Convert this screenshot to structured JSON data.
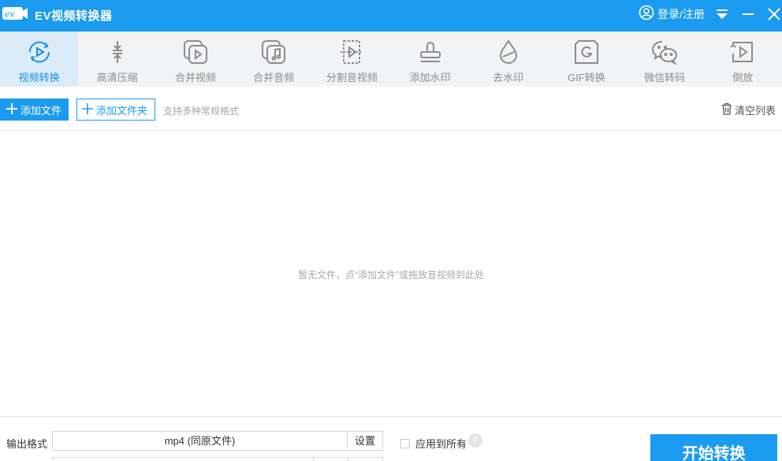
{
  "titlebar": {
    "logo_text": "EV",
    "title": "EV视频转换器",
    "login_label": "登录/注册",
    "icons": [
      "user-icon",
      "dropdown-menu-icon",
      "minimize-icon",
      "close-icon"
    ]
  },
  "toolbar": {
    "items": [
      {
        "label": "视频转换",
        "icon": "video-convert-icon",
        "active": true
      },
      {
        "label": "高清压缩",
        "icon": "compress-icon",
        "active": false
      },
      {
        "label": "合并视频",
        "icon": "merge-video-icon",
        "active": false
      },
      {
        "label": "合并音频",
        "icon": "merge-audio-icon",
        "active": false
      },
      {
        "label": "分割音视频",
        "icon": "split-icon",
        "active": false
      },
      {
        "label": "添加水印",
        "icon": "stamp-icon",
        "active": false
      },
      {
        "label": "去水印",
        "icon": "water-drop-icon",
        "active": false
      },
      {
        "label": "GIF转换",
        "icon": "gif-icon",
        "active": false
      },
      {
        "label": "微信转码",
        "icon": "wechat-icon",
        "active": false
      },
      {
        "label": "倒放",
        "icon": "reverse-icon",
        "active": false
      }
    ]
  },
  "actions": {
    "add_file": "添加文件",
    "add_folder": "添加文件夹",
    "hint": "支持多种常规格式",
    "clear_list": "清空列表"
  },
  "filelist": {
    "empty_message": "暂无文件，点“添加文件”或拖放音视频到此处"
  },
  "bottom": {
    "format_label": "输出格式",
    "format_value": "mp4 (同原文件)",
    "settings": "设置",
    "apply_all": "应用到所有",
    "apply_all_checked": false,
    "help": "?",
    "start": "开始转换"
  },
  "colors": {
    "accent": "#1a9bf0",
    "toolbar_bg": "#f2f3f5",
    "active_tab_bg": "#dcebf8",
    "active_text": "#1a8fe3",
    "muted_text": "#8c8c8c"
  }
}
